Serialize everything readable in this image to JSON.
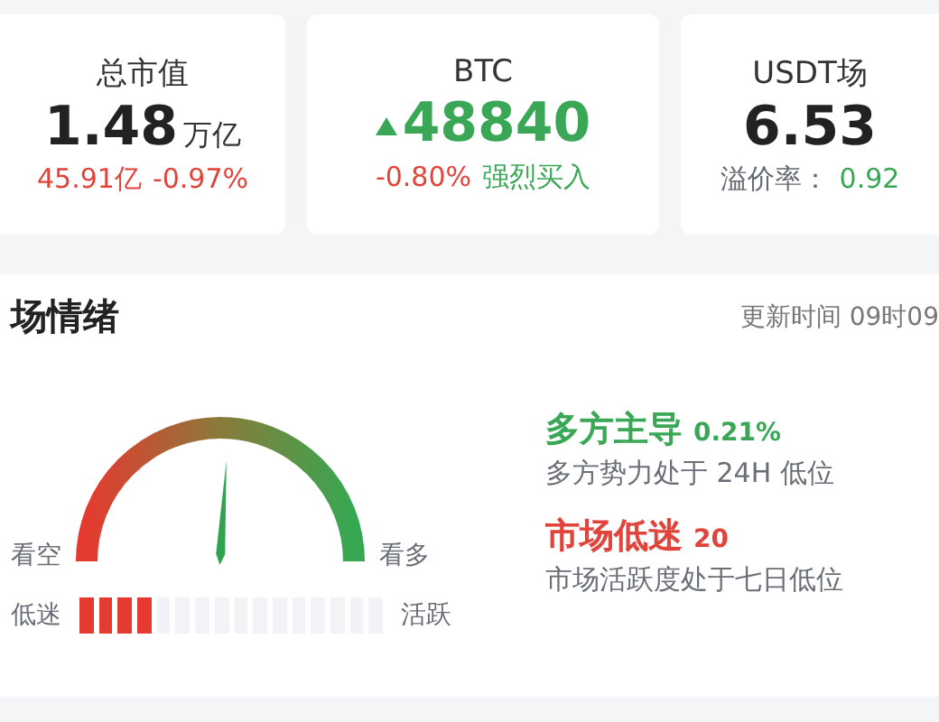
{
  "cards": [
    {
      "title": "总市值",
      "value": "1.48",
      "unit": "万亿",
      "trend_up": false,
      "changes": [
        {
          "text": "45.91亿",
          "color": "#e0443a"
        },
        {
          "text": "-0.97%",
          "color": "#e0443a"
        }
      ]
    },
    {
      "title": "BTC",
      "value": "48840",
      "trend_up": true,
      "changes": [
        {
          "text": "-0.80%",
          "color": "#e0443a"
        },
        {
          "text": "强烈买入",
          "color": "#3aa757"
        }
      ]
    },
    {
      "title": "USDT场",
      "value": "6.53",
      "trend_up": false,
      "changes": [
        {
          "text": "溢价率：",
          "color": "#666b73"
        },
        {
          "text": "0.92",
          "color": "#3aa757"
        }
      ]
    }
  ],
  "sentiment": {
    "title": "场情绪",
    "updated": "更新时间 09时09",
    "gauge": {
      "left_label": "看空",
      "right_label": "看多",
      "level": 0.52
    },
    "activity": {
      "left_label": "低迷",
      "right_label": "活跃",
      "level": 0.25
    },
    "items": [
      {
        "title": "多方主导",
        "value": "0.21%",
        "color": "#3aa757",
        "description": "多方势力处于 24H 低位"
      },
      {
        "title": "市场低迷",
        "value": "20",
        "color": "#e0443a",
        "description": "市场活跃度处于七日低位"
      }
    ]
  }
}
